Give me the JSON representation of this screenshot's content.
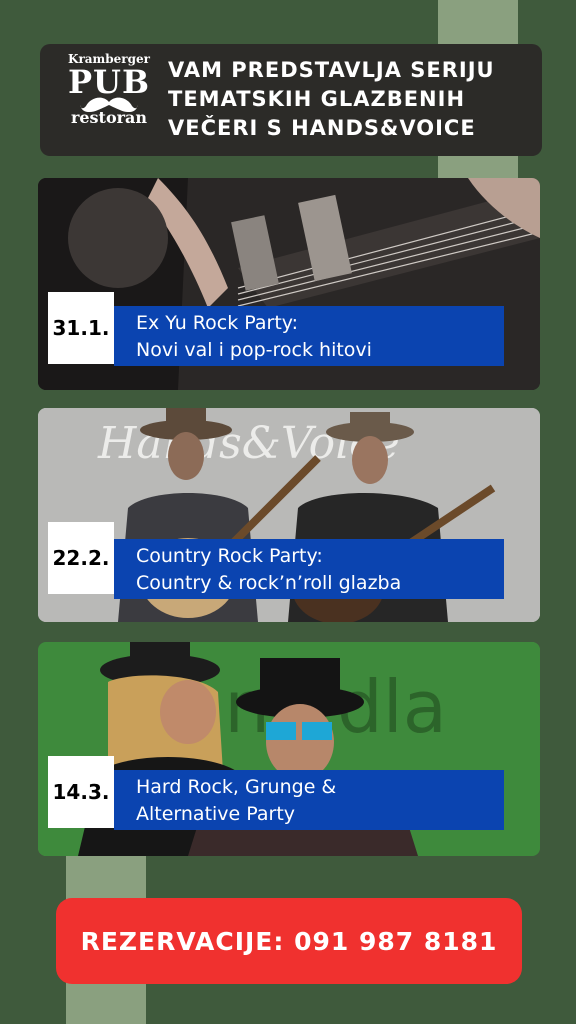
{
  "header": {
    "logo_top": "Kramberger",
    "logo_main": "PUB",
    "logo_bottom": "restoran",
    "title": "VAM PREDSTAVLJA SERIJU TEMATSKIH GLAZBENIH VEČERI S HANDS&VOICE"
  },
  "events": [
    {
      "date": "31.1.",
      "line1": "Ex Yu Rock Party:",
      "line2": "Novi val i pop-rock hitovi"
    },
    {
      "date": "22.2.",
      "line1": "Country Rock Party:",
      "line2": "Country & rock’n’roll glazba"
    },
    {
      "date": "14.3.",
      "line1": "Hard Rock, Grunge &",
      "line2": "Alternative Party"
    }
  ],
  "card_text": {
    "card2_script": "Hands&Voice",
    "card3_backdrop": "Ba  na dla"
  },
  "cta": {
    "label": "REZERVACIJE: 091 987 8181"
  },
  "colors": {
    "background": "#3f5a3c",
    "stripe": "#8aa07f",
    "header_bg": "#2c2b28",
    "event_blue": "#0b44b0",
    "cta_red": "#f0312f"
  }
}
